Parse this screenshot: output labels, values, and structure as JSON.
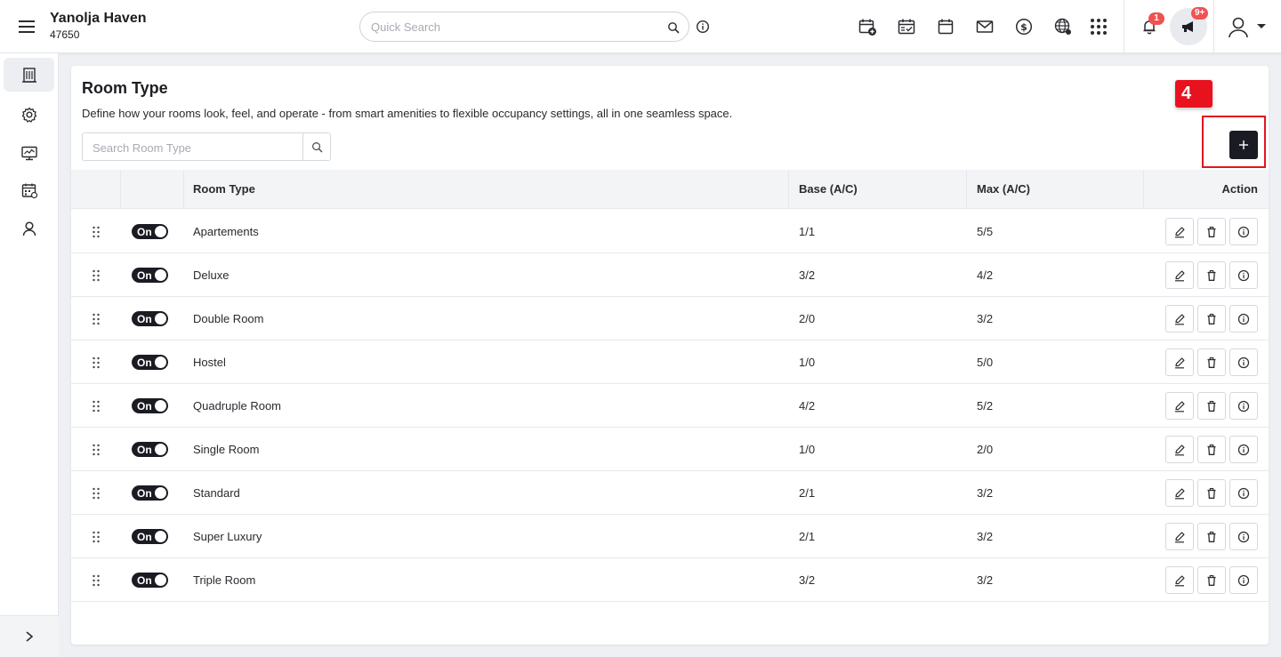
{
  "header": {
    "hotel_name": "Yanolja Haven",
    "hotel_code": "47650",
    "quick_search_placeholder": "Quick Search",
    "notifications_count": "1",
    "announcements_count": "9+",
    "icons": [
      "calendar-add-icon",
      "calendar-check-icon",
      "calendar-icon",
      "mail-icon",
      "dollar-icon",
      "globe-icon",
      "apps-grid-icon"
    ]
  },
  "sidebar": {
    "items": [
      "building-icon",
      "settings-icon",
      "monitor-icon",
      "calendar-grid-icon",
      "user-icon"
    ],
    "active_index": 0
  },
  "page": {
    "title": "Room Type",
    "description": "Define how your rooms look, feel, and operate - from smart amenities to flexible occupancy settings, all in one seamless space.",
    "search_placeholder": "Search Room Type",
    "step_badge": "4",
    "add_button_icon": "plus-icon"
  },
  "table": {
    "columns": {
      "room_type": "Room Type",
      "base": "Base (A/C)",
      "max": "Max (A/C)",
      "action": "Action"
    },
    "rows": [
      {
        "toggle": "On",
        "room_type": "Apartements",
        "base": "1/1",
        "max": "5/5"
      },
      {
        "toggle": "On",
        "room_type": "Deluxe",
        "base": "3/2",
        "max": "4/2"
      },
      {
        "toggle": "On",
        "room_type": "Double Room",
        "base": "2/0",
        "max": "3/2"
      },
      {
        "toggle": "On",
        "room_type": "Hostel",
        "base": "1/0",
        "max": "5/0"
      },
      {
        "toggle": "On",
        "room_type": "Quadruple Room",
        "base": "4/2",
        "max": "5/2"
      },
      {
        "toggle": "On",
        "room_type": "Single Room",
        "base": "1/0",
        "max": "2/0"
      },
      {
        "toggle": "On",
        "room_type": "Standard",
        "base": "2/1",
        "max": "3/2"
      },
      {
        "toggle": "On",
        "room_type": "Super Luxury",
        "base": "2/1",
        "max": "3/2"
      },
      {
        "toggle": "On",
        "room_type": "Triple Room",
        "base": "3/2",
        "max": "3/2"
      }
    ]
  },
  "colors": {
    "primary_dark": "#1b1b24",
    "badge_red": "#f05252",
    "highlight_red": "#e0161f"
  }
}
